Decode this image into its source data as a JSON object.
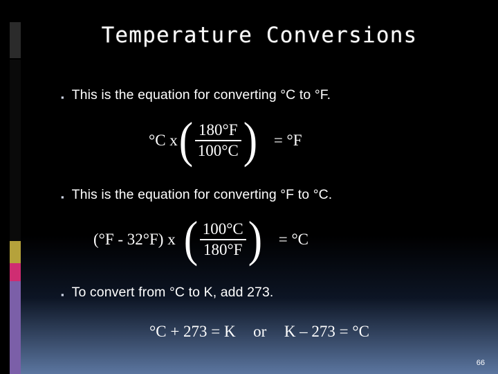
{
  "slide": {
    "title": "Temperature Conversions",
    "page_number": "66",
    "colors": {
      "background": "#000000",
      "text": "#ffffff",
      "accent_yellow": "#b5a23b",
      "accent_magenta": "#cf2d72",
      "accent_violet": "#7b5fa8",
      "wash_blue": "#607ca8"
    }
  },
  "bullets": [
    {
      "marker": "▪",
      "text": "This is the equation for converting °C to °F."
    },
    {
      "marker": "▪",
      "text": "This is the equation for converting °F to °C."
    },
    {
      "marker": "▪",
      "text": "To convert from °C to K, add 273."
    }
  ],
  "equations": [
    {
      "lead": "°C x",
      "open_paren": "(",
      "numerator": "180°F",
      "denominator": "100°C",
      "close_paren": ")",
      "result": "=  °F"
    },
    {
      "lead": "(°F - 32°F) x",
      "open_paren": "(",
      "numerator": "100°C",
      "denominator": "180°F",
      "close_paren": ")",
      "result": "=  °C"
    }
  ],
  "equation_line": {
    "left": "°C + 273 = K",
    "connector": "or",
    "right": "K – 273 = °C"
  }
}
